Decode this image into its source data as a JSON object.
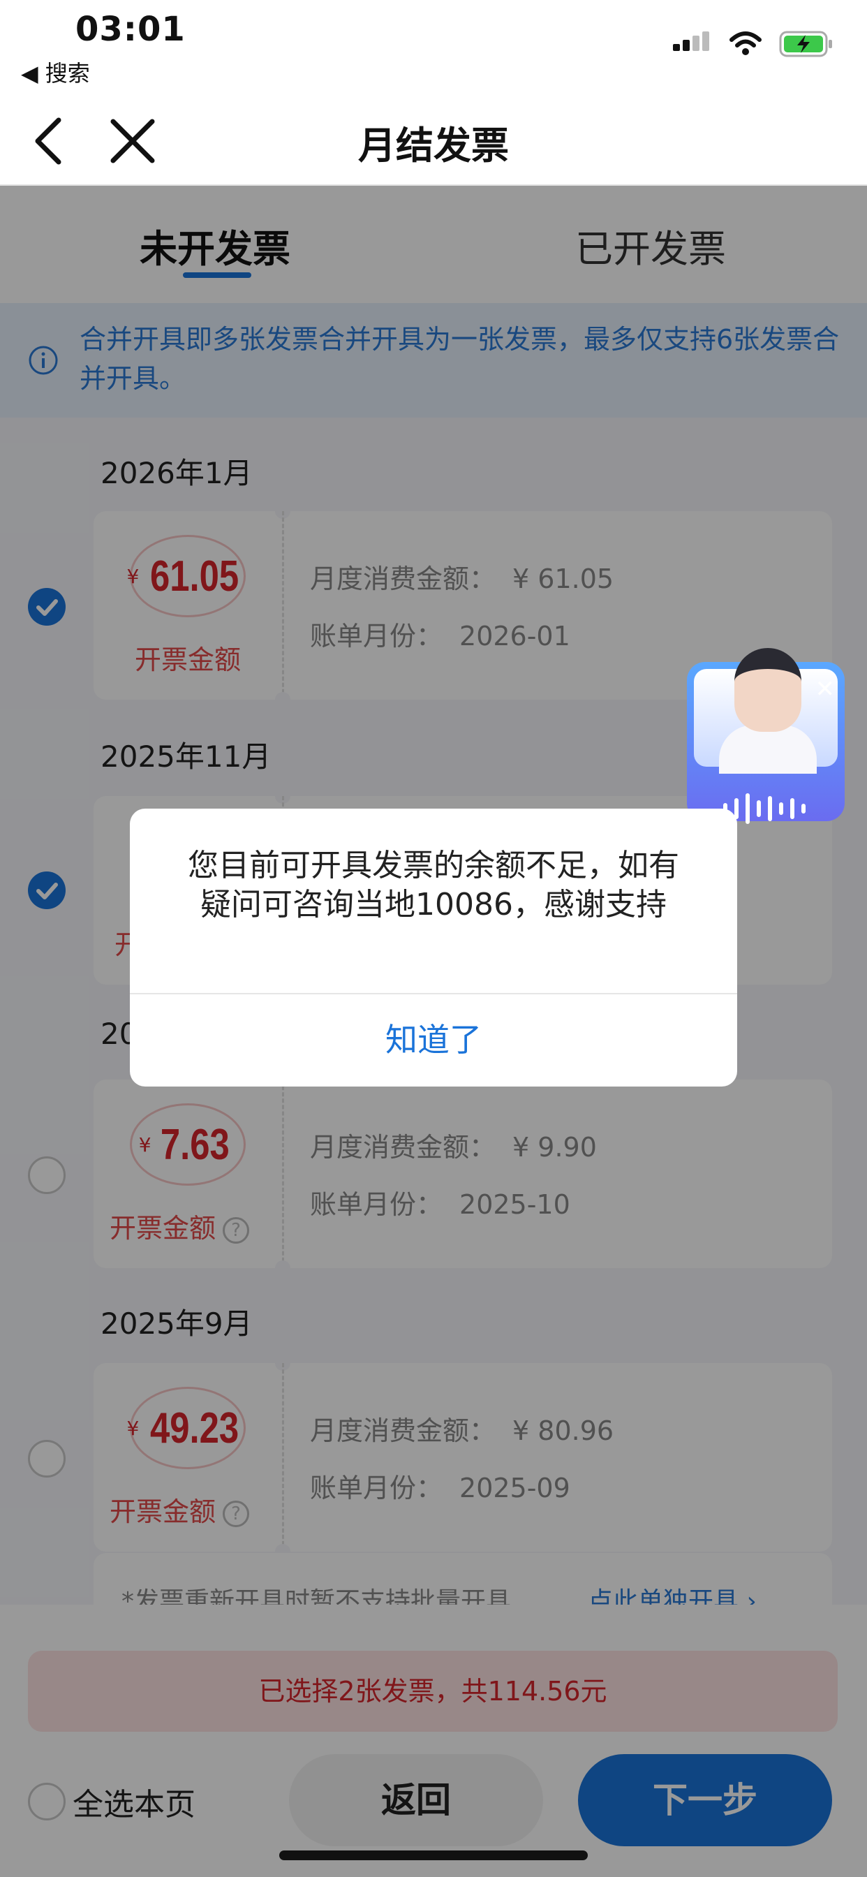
{
  "status_bar": {
    "time": "03:01",
    "back_app": "◀ 搜索"
  },
  "nav": {
    "title": "月结发票"
  },
  "tabs": [
    {
      "label": "未开发票",
      "active": true
    },
    {
      "label": "已开发票",
      "active": false
    }
  ],
  "notice": {
    "text": "合并开具即多张发票合并开具为一张发票，最多仅支持6张发票合并开具。"
  },
  "invoices": [
    {
      "month": "2026年1月",
      "amount": "61.05",
      "amount_label": "开票金额",
      "monthly_label": "月度消费金额：",
      "monthly_value": "¥ 61.05",
      "bill_label": "账单月份：",
      "bill_value": "2026-01",
      "selected": true,
      "has_help": false
    },
    {
      "month": "2025年11月",
      "amount": "",
      "amount_label": "开",
      "monthly_label": "",
      "monthly_value": "",
      "bill_label": "",
      "bill_value": "",
      "selected": true,
      "has_help": false
    },
    {
      "month": "20",
      "amount": "7.63",
      "amount_label": "开票金额",
      "monthly_label": "月度消费金额：",
      "monthly_value": "¥ 9.90",
      "bill_label": "账单月份：",
      "bill_value": "2025-10",
      "selected": false,
      "has_help": true
    },
    {
      "month": "2025年9月",
      "amount": "49.23",
      "amount_label": "开票金额",
      "monthly_label": "月度消费金额：",
      "monthly_value": "¥ 80.96",
      "bill_label": "账单月份：",
      "bill_value": "2025-09",
      "selected": false,
      "has_help": true
    }
  ],
  "footnote": {
    "text": "*发票重新开具时暂不支持批量开具",
    "link": "点此单独开具 ›"
  },
  "bottom": {
    "selected_summary": "已选择2张发票，共114.56元",
    "select_all": "全选本页",
    "back": "返回",
    "next": "下一步"
  },
  "dialog": {
    "message": "您目前可开具发票的余额不足，如有疑问可咨询当地10086，感谢支持",
    "ok": "知道了"
  },
  "colors": {
    "accent": "#1a73d9",
    "amount_red": "#d6262c"
  }
}
